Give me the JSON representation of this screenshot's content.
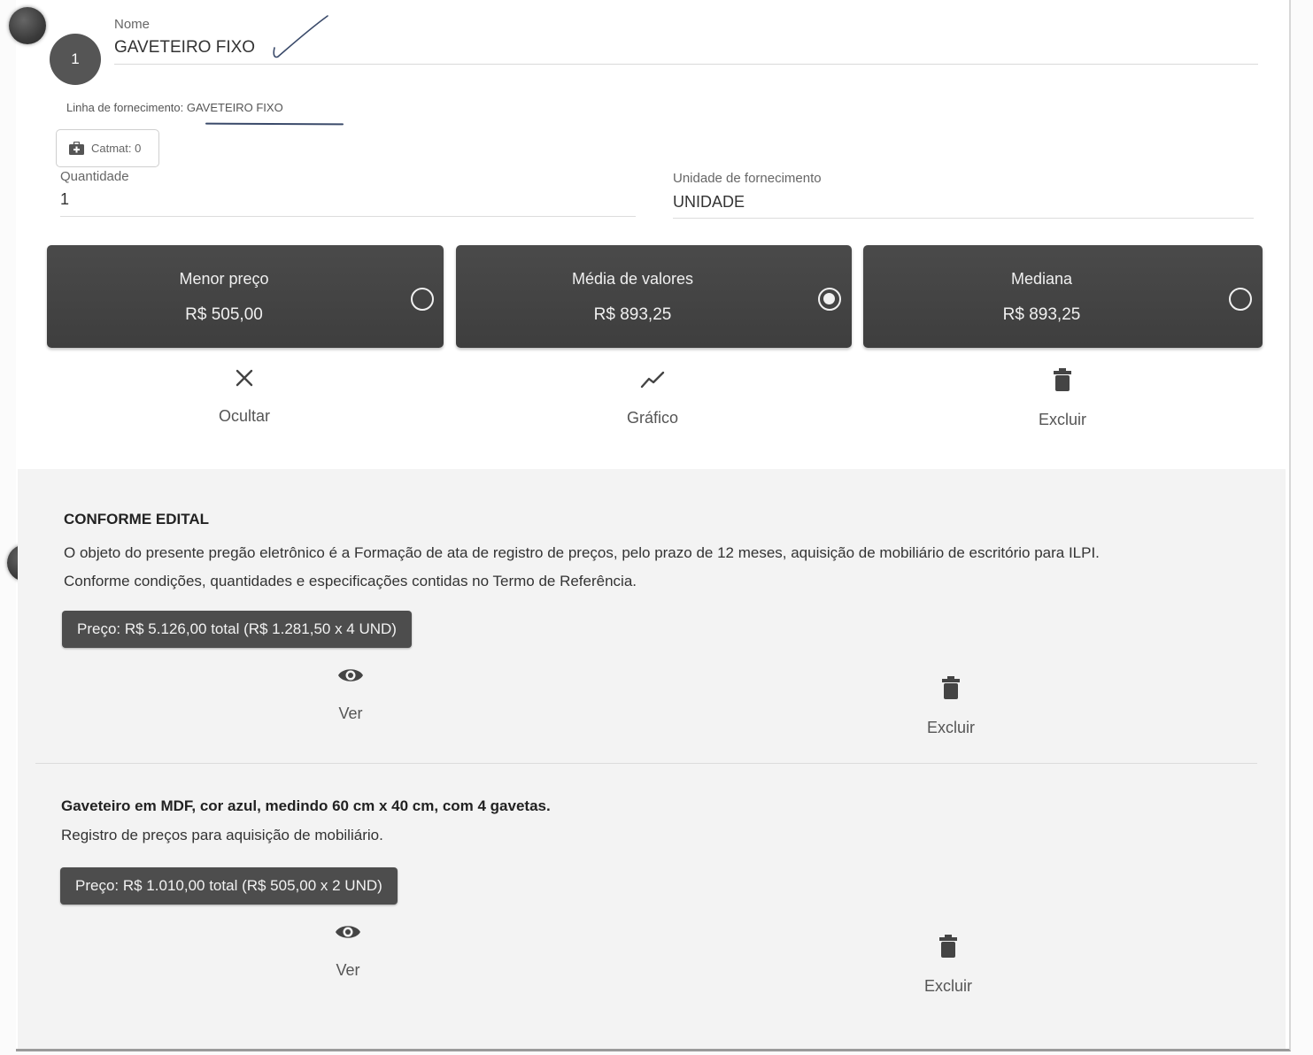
{
  "item": {
    "number": "1",
    "name_label": "Nome",
    "name_value": "GAVETEIRO FIXO",
    "supply_line": "Linha de fornecimento: GAVETEIRO FIXO",
    "catmat_label": "Catmat: 0",
    "quantity_label": "Quantidade",
    "quantity_value": "1",
    "unit_label": "Unidade de fornecimento",
    "unit_value": "UNIDADE"
  },
  "stats": [
    {
      "title": "Menor preço",
      "value": "R$ 505,00",
      "selected": false
    },
    {
      "title": "Média de valores",
      "value": "R$ 893,25",
      "selected": true
    },
    {
      "title": "Mediana",
      "value": "R$ 893,25",
      "selected": false
    }
  ],
  "actions": {
    "hide": "Ocultar",
    "chart": "Gráfico",
    "delete": "Excluir"
  },
  "quotes": [
    {
      "title": "CONFORME EDITAL",
      "description_1": "O objeto do presente pregão eletrônico é a Formação de ata de registro de preços, pelo prazo de 12 meses, aquisição de mobiliário de escritório para ILPI.",
      "description_2": "Conforme condições, quantidades e especificações contidas no Termo de Referência.",
      "price": "Preço: R$ 5.126,00 total (R$ 1.281,50 x 4 UND)",
      "view_label": "Ver",
      "delete_label": "Excluir"
    },
    {
      "title": "Gaveteiro em MDF, cor azul, medindo 60 cm x 40 cm, com 4 gavetas.",
      "description_1": "Registro de preços para aquisição de mobiliário.",
      "price": "Preço: R$ 1.010,00 total (R$ 505,00 x 2 UND)",
      "view_label": "Ver",
      "delete_label": "Excluir"
    }
  ],
  "icons": {
    "hide": "close-icon",
    "chart": "trending-icon",
    "delete": "trash-icon",
    "view": "eye-icon",
    "catmat": "medkit-icon"
  },
  "colors": {
    "card_bg": "#444444",
    "pill_bg": "#4d4d4d",
    "section_bg": "#f3f3f3"
  }
}
